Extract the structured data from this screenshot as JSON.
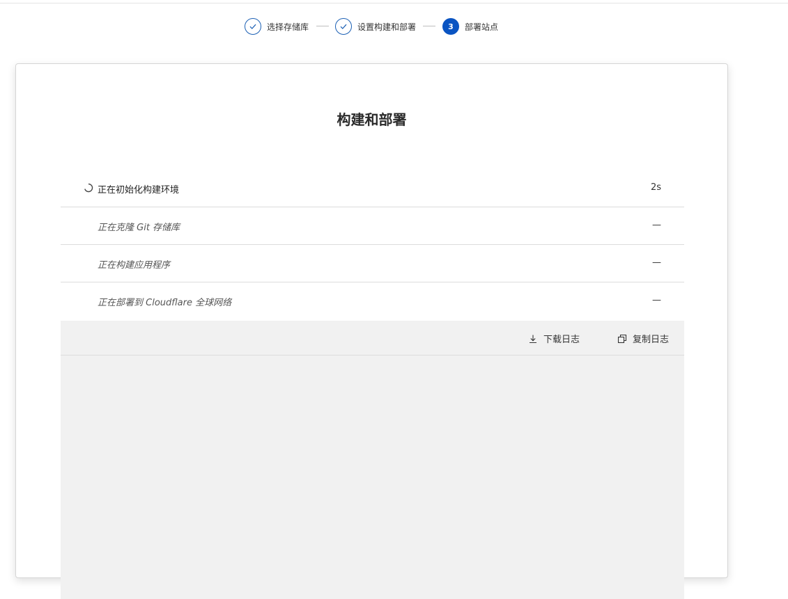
{
  "stepper": {
    "steps": [
      {
        "label": "选择存储库",
        "state": "done",
        "icon": "check-icon"
      },
      {
        "label": "设置构建和部署",
        "state": "done",
        "icon": "check-icon"
      },
      {
        "label": "部署站点",
        "state": "current",
        "number": "3"
      }
    ]
  },
  "card": {
    "title": "构建和部署",
    "tasks": [
      {
        "label": "正在初始化构建环境",
        "time": "2s",
        "status": "in-progress",
        "icon": "spinner-icon"
      },
      {
        "label": "正在克隆 Git 存储库",
        "time": "—",
        "status": "pending"
      },
      {
        "label": "正在构建应用程序",
        "time": "—",
        "status": "pending"
      },
      {
        "label": "正在部署到 Cloudflare 全球网络",
        "time": "—",
        "status": "pending"
      }
    ],
    "log_toolbar": {
      "download_label": "下载日志",
      "download_icon": "download-icon",
      "copy_label": "复制日志",
      "copy_icon": "copy-icon"
    }
  },
  "colors": {
    "accent": "#0a54c2",
    "done_border": "#1a5fb4",
    "log_background": "#f1f1f1",
    "divider": "#dcdcdc"
  }
}
